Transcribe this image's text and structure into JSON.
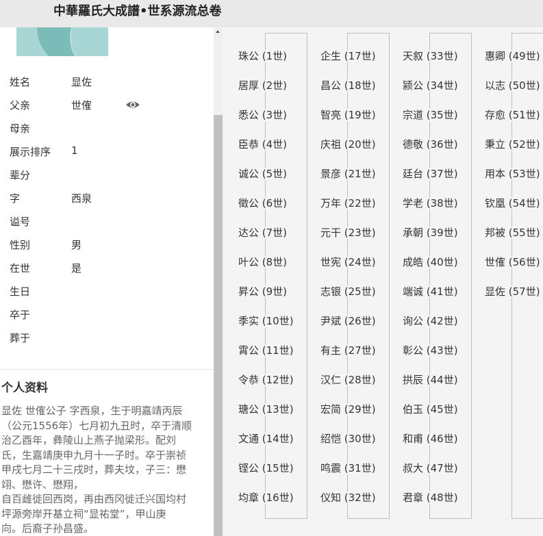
{
  "page": {
    "title": "中華羅氏大成譜•世系源流总卷"
  },
  "profile": {
    "fields": [
      {
        "label": "姓名",
        "value": "显佐"
      },
      {
        "label": "父亲",
        "value": "世傕"
      },
      {
        "label": "母亲",
        "value": ""
      },
      {
        "label": "展示排序",
        "value": "1"
      },
      {
        "label": "辈分",
        "value": ""
      },
      {
        "label": "字",
        "value": "西泉"
      },
      {
        "label": "谥号",
        "value": ""
      },
      {
        "label": "性别",
        "value": "男"
      },
      {
        "label": "在世",
        "value": "是"
      },
      {
        "label": "生日",
        "value": ""
      },
      {
        "label": "卒于",
        "value": ""
      },
      {
        "label": "葬于",
        "value": ""
      }
    ],
    "section_title": "个人资料",
    "bio_lines": [
      "显佐  世傕公子 字西泉，生于明嘉靖丙辰",
      "（公元1556年）七月初九丑时，卒于清顺",
      "治乙酉年，彝陵山上燕子抛梁形。配刘",
      "氏，生嘉靖庚申九月十一子时。卒于崇祯",
      "甲戌七月二十三戌时，葬夫坟，子三：懋",
      "翊、懋许、懋翔，",
      "自百雌徙回西岗，再由西冈徙迁兴国均村",
      "坪源旁岸开基立祠“显祐堂”，甲山庚",
      "向。后裔子孙昌盛。"
    ]
  },
  "lineage": {
    "columns": [
      [
        "珠公 (1世)",
        "居厚 (2世)",
        "悉公 (3世)",
        "臣恭 (4世)",
        "诚公 (5世)",
        "徵公 (6世)",
        "达公 (7世)",
        "叶公 (8世)",
        "昇公 (9世)",
        "季实 (10世)",
        "霄公 (11世)",
        "令恭 (12世)",
        "瑭公 (13世)",
        "文通 (14世)",
        "铿公 (15世)",
        "均章 (16世)"
      ],
      [
        "企生 (17世)",
        "昌公 (18世)",
        "智亮 (19世)",
        "庆祖 (20世)",
        "景彦 (21世)",
        "万年 (22世)",
        "元干 (23世)",
        "世宪 (24世)",
        "志银 (25世)",
        "尹斌 (26世)",
        "有主 (27世)",
        "汉仁 (28世)",
        "宏简 (29世)",
        "绍恺 (30世)",
        "鸣震 (31世)",
        "仪知 (32世)"
      ],
      [
        "天叙 (33世)",
        "颍公 (34世)",
        "宗道 (35世)",
        "德敬 (36世)",
        "廷台 (37世)",
        "学老 (38世)",
        "承朝 (39世)",
        "成皓 (40世)",
        "端诚 (41世)",
        "询公 (42世)",
        "彰公 (43世)",
        "拱辰 (44世)",
        "伯玉 (45世)",
        "和甫 (46世)",
        "叔大 (47世)",
        "君章 (48世)"
      ],
      [
        "惠卿 (49世)",
        "以志 (50世)",
        "存愈 (51世)",
        "秉立 (52世)",
        "用本 (53世)",
        "钦凰 (54世)",
        "邦被 (55世)",
        "世傕 (56世)",
        "显佐 (57世)"
      ]
    ]
  }
}
